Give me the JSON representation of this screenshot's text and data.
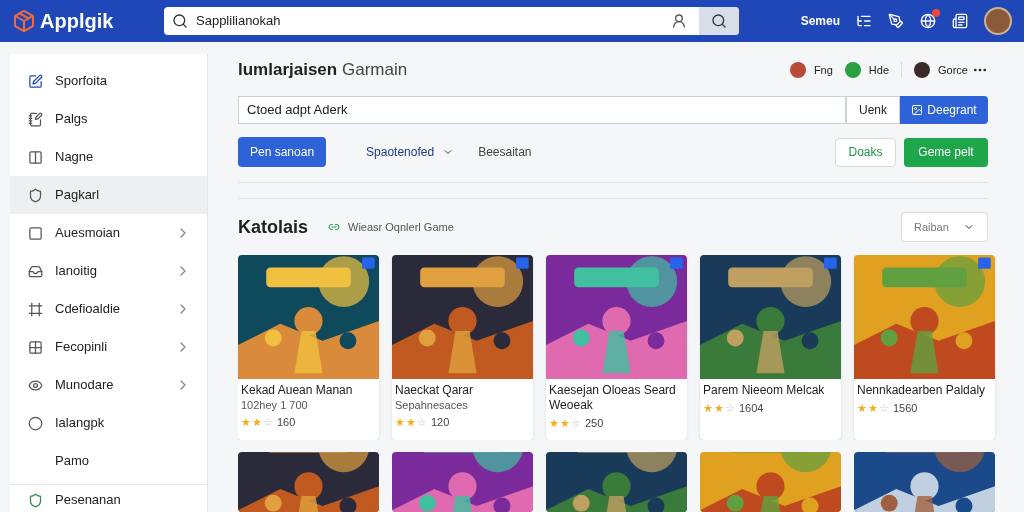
{
  "header": {
    "logo": "Applgik",
    "search": {
      "value": "Sapplilianokah"
    },
    "user_label": "Semeu",
    "notification_badge": true
  },
  "sidebar": {
    "items": [
      {
        "label": "Sporfoita",
        "selected": false,
        "chevron": false
      },
      {
        "label": "Palgs",
        "selected": false,
        "chevron": false
      },
      {
        "label": "Nagne",
        "selected": false,
        "chevron": false
      },
      {
        "label": "Pagkarl",
        "selected": true,
        "chevron": false
      },
      {
        "label": "Auesmoian",
        "selected": false,
        "chevron": true
      },
      {
        "label": "Ianoitig",
        "selected": false,
        "chevron": true
      },
      {
        "label": "Cdefioaldie",
        "selected": false,
        "chevron": true
      },
      {
        "label": "Fecopinli",
        "selected": false,
        "chevron": true
      },
      {
        "label": "Munodare",
        "selected": false,
        "chevron": true
      },
      {
        "label": "Ialangpk",
        "selected": false,
        "chevron": false
      },
      {
        "label": "Pamo",
        "selected": false,
        "chevron": false
      }
    ],
    "footer_item": {
      "label": "Pesenanan"
    }
  },
  "main": {
    "title_bold": "lumlarjaisen",
    "title_rest": "Garmain",
    "people": [
      {
        "name": "Fng",
        "kind": "avatar"
      },
      {
        "name": "Hde",
        "kind": "green"
      },
      {
        "name": "Gorce",
        "kind": "avatar"
      }
    ],
    "input": {
      "value": "Ctoed adpt Aderk"
    },
    "input_buttons": [
      "Uenk",
      "Deegrant"
    ],
    "actions": [
      {
        "label": "Pen sanoan",
        "kind": "primary"
      },
      {
        "label": "Spaotenofed",
        "kind": "dropdown"
      },
      {
        "label": "Beesaitan",
        "kind": "text"
      }
    ],
    "right_actions": [
      {
        "label": "Doaks",
        "kind": "outline"
      },
      {
        "label": "Geme pelt",
        "kind": "filled"
      }
    ],
    "section": {
      "title": "Katolais",
      "subtitle": "Wieasr Oqnlerl Game",
      "sort": "Raiban"
    },
    "cards": [
      {
        "title": "Kekad Auean Manan",
        "subtitle": "102hey 1 700",
        "stars": 2,
        "rating": "160"
      },
      {
        "title": "Naeckat Qarar",
        "subtitle": "Sepahnesaces",
        "stars": 2,
        "rating": "120"
      },
      {
        "title": "Kaesejan Oloeas Seard Weoeak",
        "stars": 2,
        "rating": "250"
      },
      {
        "title": "Parem Nieeom Melcak",
        "stars": 2,
        "rating": "1604"
      },
      {
        "title": "Nennkadearben Paldaly",
        "stars": 2,
        "rating": "1560"
      }
    ]
  }
}
